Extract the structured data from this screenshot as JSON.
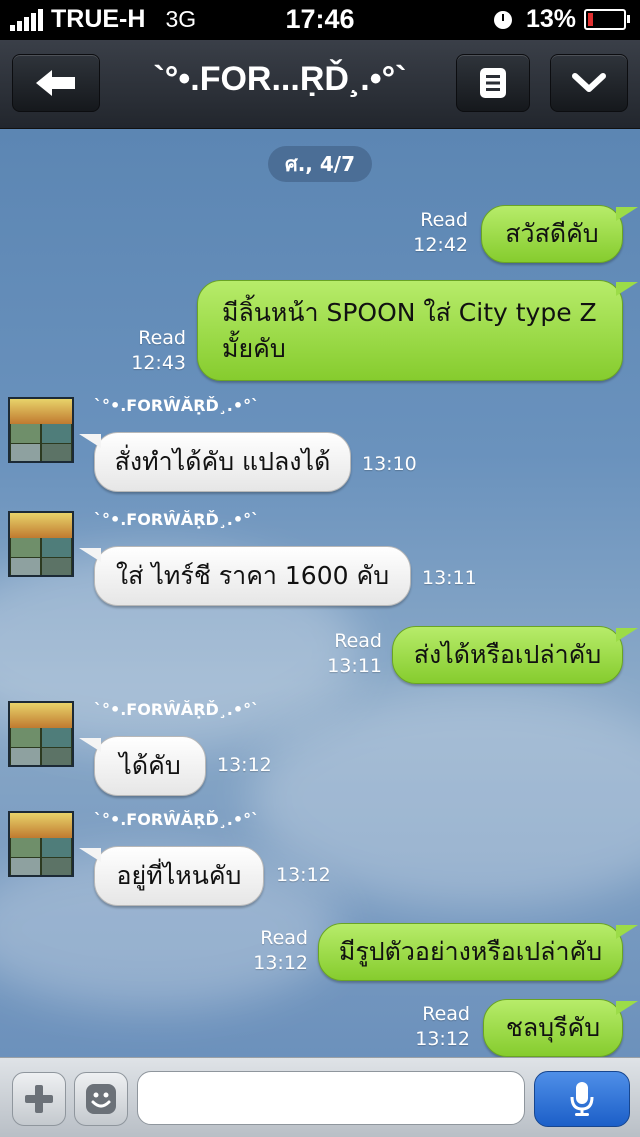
{
  "status_bar": {
    "carrier": "TRUE-H",
    "network": "3G",
    "time": "17:46",
    "battery": "13%"
  },
  "header": {
    "title": "`°•.FOR...ṚĎ¸.•°`"
  },
  "chat": {
    "date_label": "ศ., 4/7",
    "sender_name": "`°•.FORŴĂṚĎ¸.•°`",
    "messages": [
      {
        "text": "สวัสดีคับ",
        "read": "Read",
        "time": "12:42"
      },
      {
        "text": "มีลิ้นหน้า SPOON ใส่ City type Z มั้ยคับ",
        "read": "Read",
        "time": "12:43"
      },
      {
        "text": "สั่งทำได้คับ แปลงได้",
        "time": "13:10"
      },
      {
        "text": "ใส่ ไทร์ชี ราคา 1600 คับ",
        "time": "13:11"
      },
      {
        "text": "ส่งได้หรือเปล่าคับ",
        "read": "Read",
        "time": "13:11"
      },
      {
        "text": "ได้คับ",
        "time": "13:12"
      },
      {
        "text": "อยู่ที่ไหนคับ",
        "time": "13:12"
      },
      {
        "text": "มีรูปตัวอย่างหรือเปล่าคับ",
        "read": "Read",
        "time": "13:12"
      },
      {
        "text": "ชลบุรีคับ",
        "read": "Read",
        "time": "13:12"
      }
    ]
  },
  "input": {
    "placeholder": ""
  },
  "colors": {
    "outgoing_bubble": "#9cdc48",
    "incoming_bubble": "#f4f4f4",
    "mic_button": "#2a6fd6"
  }
}
